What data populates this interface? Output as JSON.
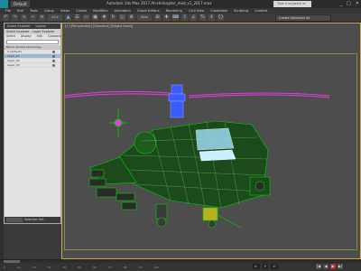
{
  "titlebar": {
    "workspace": "Default",
    "title": "Autodesk 3ds Max 2017    Ah-Helicopter_mod_v1_2017.max",
    "search_placeholder": "Type a keyword or phrase",
    "minimize": "_",
    "maximize": "□",
    "close": "✕"
  },
  "menu": [
    "File",
    "Edit",
    "Tools",
    "Group",
    "Views",
    "Create",
    "Modifiers",
    "Animation",
    "Graph Editors",
    "Rendering",
    "Civil View",
    "Customize",
    "Scripting",
    "Content"
  ],
  "toolbar": {
    "view_label": "View",
    "selection_set": "Create Selection Se"
  },
  "explorer": {
    "tabs": [
      "Scene Explorer",
      "Layers"
    ],
    "title": "Scene Explorer - Layer Explorer",
    "menu": [
      "Select",
      "Display",
      "Edit",
      "Customize"
    ],
    "search_placeholder": "",
    "column_header": "Name (Sorted Ascending)",
    "rows": [
      {
        "label": "0 (default)",
        "selected": false
      },
      {
        "label": "Layer_01",
        "selected": true
      },
      {
        "label": "Layer_02",
        "selected": false
      },
      {
        "label": "Layer_03",
        "selected": false
      }
    ],
    "footer_label": "Selection Set:"
  },
  "viewport": {
    "label": "[+] [Perspective] [Standard] [Edged Faces]"
  },
  "statusbar": {
    "frames": [
      "0",
      "10",
      "20",
      "30",
      "40",
      "50",
      "60",
      "70",
      "80",
      "90",
      "100"
    ],
    "x": "X:",
    "y": "Y:",
    "z": "Z:",
    "play_buttons": [
      "|◀",
      "◀",
      "▶",
      "▶|"
    ]
  },
  "colors": {
    "accent": "#1a8a9a",
    "viewport_border": "#c9a84a",
    "mesh_green": "#00c000",
    "mesh_magenta": "#e040e0",
    "rotor_blue": "#3a5cff"
  }
}
